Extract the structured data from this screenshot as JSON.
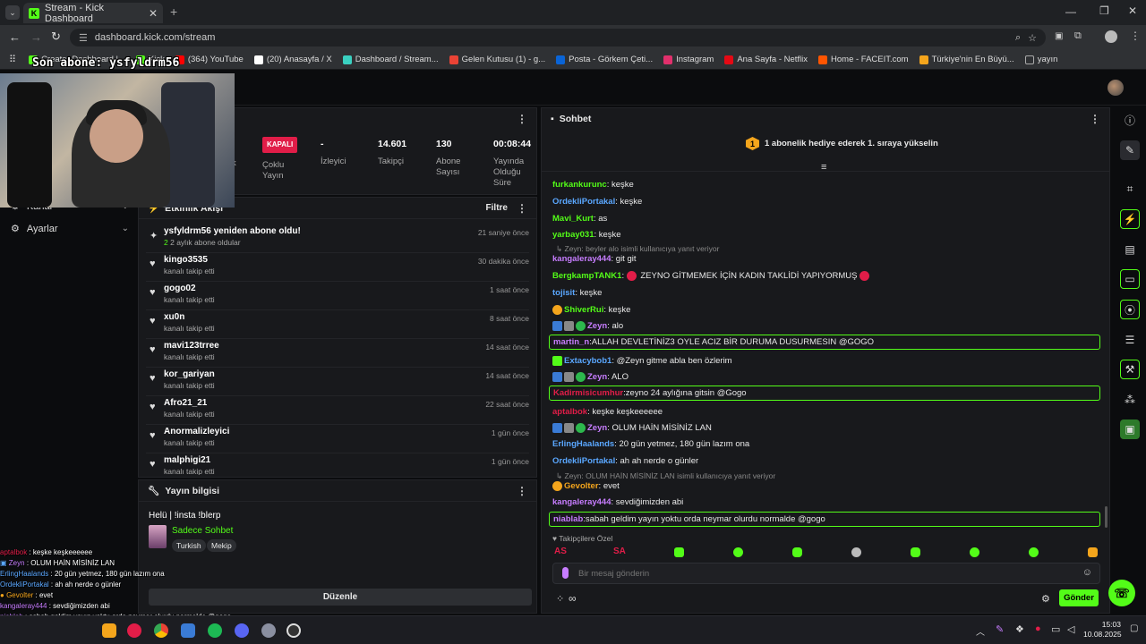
{
  "browser": {
    "tab_title": "Stream - Kick Dashboard",
    "url": "dashboard.kick.com/stream",
    "bookmarks": [
      {
        "label": "Creator Dashboard |...",
        "color": "#53fc18"
      },
      {
        "label": "Kick",
        "color": "#53fc18"
      },
      {
        "label": "(364) YouTube",
        "color": "#ff0000"
      },
      {
        "label": "(20) Anasayfa / X",
        "color": "#ffffff"
      },
      {
        "label": "Dashboard / Stream...",
        "color": "#3ad0c0"
      },
      {
        "label": "Gelen Kutusu (1) - g...",
        "color": "#ea4335"
      },
      {
        "label": "Posta - Görkem Çeti...",
        "color": "#0a64d6"
      },
      {
        "label": "Instagram",
        "color": "#e1306c"
      },
      {
        "label": "Ana Sayfa - Netflix",
        "color": "#e50914"
      },
      {
        "label": "Home - FACEIT.com",
        "color": "#ff5500"
      },
      {
        "label": "Türkiye'nin En Büyü...",
        "color": "#f4a51c"
      },
      {
        "label": "yayın",
        "color": "#777777"
      }
    ]
  },
  "overlay": {
    "last_sub": "Son abone: ysfyldrm56"
  },
  "leftnav": {
    "items": [
      {
        "label": "Kanal",
        "icon": "settings-icon"
      },
      {
        "label": "Ayarlar",
        "icon": "gear-icon"
      }
    ]
  },
  "stats": {
    "status_badge": "KAPALI",
    "multi_label": "Çoklu Yayın",
    "partial_label": "k",
    "viewers_value": "-",
    "viewers_label": "İzleyici",
    "followers_value": "14.601",
    "followers_label": "Takipçi",
    "subs_value": "130",
    "subs_label": "Abone Sayısı",
    "uptime_value": "00:08:44",
    "uptime_label": "Yayında Olduğu Süre"
  },
  "activity": {
    "title": "Etkinlik Akışı",
    "filter_label": "Filtre",
    "items": [
      {
        "name": "ysfyldrm56 yeniden abone oldu!",
        "sub": "2 aylık abone oldular",
        "time": "21 saniye önce",
        "icon": "sparkle-icon"
      },
      {
        "name": "kingo3535",
        "sub": "kanalı takip etti",
        "time": "30 dakika önce",
        "icon": "heart-icon"
      },
      {
        "name": "gogo02",
        "sub": "kanalı takip etti",
        "time": "1 saat önce",
        "icon": "heart-icon"
      },
      {
        "name": "xu0n",
        "sub": "kanalı takip etti",
        "time": "8 saat önce",
        "icon": "heart-icon"
      },
      {
        "name": "mavi123trree",
        "sub": "kanalı takip etti",
        "time": "14 saat önce",
        "icon": "heart-icon"
      },
      {
        "name": "kor_gariyan",
        "sub": "kanalı takip etti",
        "time": "14 saat önce",
        "icon": "heart-icon"
      },
      {
        "name": "Afro21_21",
        "sub": "kanalı takip etti",
        "time": "22 saat önce",
        "icon": "heart-icon"
      },
      {
        "name": "Anormalizleyici",
        "sub": "kanalı takip etti",
        "time": "1 gün önce",
        "icon": "heart-icon"
      },
      {
        "name": "malphigi21",
        "sub": "kanalı takip etti",
        "time": "1 gün önce",
        "icon": "heart-icon"
      }
    ]
  },
  "streaminfo": {
    "title": "Yayın bilgisi",
    "stream_title": "Helü | !insta !blerp",
    "category": "Sadece Sohbet",
    "tags": [
      "Turkish",
      "Mekip"
    ],
    "edit_button": "Düzenle"
  },
  "chat": {
    "title": "Sohbet",
    "gift_banner": "1 abonelik hediye ederek 1. sıraya yükselin",
    "gift_rank": "1",
    "lines": [
      {
        "user": "furkankurunc",
        "color": "#53fc18",
        "msg": "keşke",
        "type": "line"
      },
      {
        "user": "OrdekliPortakal",
        "color": "#5aa7ff",
        "msg": "keşke",
        "type": "line"
      },
      {
        "user": "Mavi_Kurt",
        "color": "#53fc18",
        "msg": "as",
        "type": "line"
      },
      {
        "user": "yarbay031",
        "color": "#53fc18",
        "msg": "keşke",
        "type": "line"
      },
      {
        "reply": "Zeyn: beyler alo isimli kullanıcıya yanıt veriyor",
        "type": "reply"
      },
      {
        "user": "kangaleray444",
        "color": "#c77dff",
        "msg": "git git",
        "type": "line"
      },
      {
        "user": "BergkampTANK1",
        "color": "#53fc18",
        "msg": "ZEYNO GİTMEMEK İÇİN KADIN TAKLİDİ YAPIYORMUŞ",
        "type": "line"
      },
      {
        "user": "tojisit",
        "color": "#5aa7ff",
        "msg": "keşke",
        "type": "line"
      },
      {
        "user": "ShiverRui",
        "color": "#53fc18",
        "msg": "keşke",
        "type": "line"
      },
      {
        "user": "Zeyn",
        "color": "#c77dff",
        "msg": "alo",
        "type": "line"
      },
      {
        "user": "martin_n",
        "color": "#c77dff",
        "msg": "ALLAH DEVLETİNİZ3 OYLE ACIZ BİR DURUMA DUSURMESIN @GOGO",
        "type": "highlight"
      },
      {
        "user": "Extacybob1",
        "color": "#5aa7ff",
        "msg": "@Zeyn gitme abla ben özlerim",
        "type": "line"
      },
      {
        "user": "Zeyn",
        "color": "#c77dff",
        "msg": "ALO",
        "type": "line"
      },
      {
        "user": "Kadirmisicumhur",
        "color": "#e11d48",
        "msg": "zeyno 24 aylığına gitsin @Gogo",
        "type": "highlight"
      },
      {
        "user": "aptalbok",
        "color": "#e11d48",
        "msg": "keşke keşkeeeeee",
        "type": "line"
      },
      {
        "user": "Zeyn",
        "color": "#c77dff",
        "msg": "OLUM HAİN MİSİNİZ LAN",
        "type": "line"
      },
      {
        "user": "ErlingHaalands",
        "color": "#5aa7ff",
        "msg": "20 gün yetmez, 180 gün lazım ona",
        "type": "line"
      },
      {
        "user": "OrdekliPortakal",
        "color": "#5aa7ff",
        "msg": "ah ah nerde o günler",
        "type": "line"
      },
      {
        "reply": "Zeyn: OLUM HAİN MİSİNİZ LAN isimli kullanıcıya yanıt veriyor",
        "type": "reply"
      },
      {
        "user": "Gevolter",
        "color": "#f4a51c",
        "msg": "evet",
        "type": "line"
      },
      {
        "user": "kangaleray444",
        "color": "#c77dff",
        "msg": "sevdiğimizden abi",
        "type": "line"
      },
      {
        "user": "niablab",
        "color": "#c77dff",
        "msg": "sabah geldim yayın yoktu orda neymar olurdu normalde @gogo",
        "type": "highlight"
      }
    ],
    "followers_only": "Takipçilere Özel",
    "emote_labels": [
      "AS",
      "SA"
    ],
    "input_placeholder": "Bir mesaj gönderin",
    "send_button": "Gönder"
  },
  "overlay_chat": [
    {
      "user": "aptalbok",
      "color": "#e11d48",
      "msg": "keşke keşkeeeeee"
    },
    {
      "user": "Zeyn",
      "color": "#c77dff",
      "msg": "OLUM HAİN MİSİNİZ LAN"
    },
    {
      "user": "ErlingHaalands",
      "color": "#5aa7ff",
      "msg": "20 gün yetmez, 180 gün lazım ona"
    },
    {
      "user": "OrdekliPortakal",
      "color": "#5aa7ff",
      "msg": "ah ah nerde o günler"
    },
    {
      "user": "Gevolter",
      "color": "#f4a51c",
      "msg": "evet"
    },
    {
      "user": "kangaleray444",
      "color": "#c77dff",
      "msg": "sevdiğimizden abi"
    },
    {
      "user": "niablab",
      "color": "#c77dff",
      "msg": "sabah geldim yayın yoktu orda neymar olurdu normalde @gogo"
    }
  ],
  "taskbar": {
    "time": "15:03",
    "date": "10.08.2025"
  },
  "colors": {
    "accent": "#53fc18",
    "panel": "#18191c",
    "background": "#0b0c0e"
  }
}
